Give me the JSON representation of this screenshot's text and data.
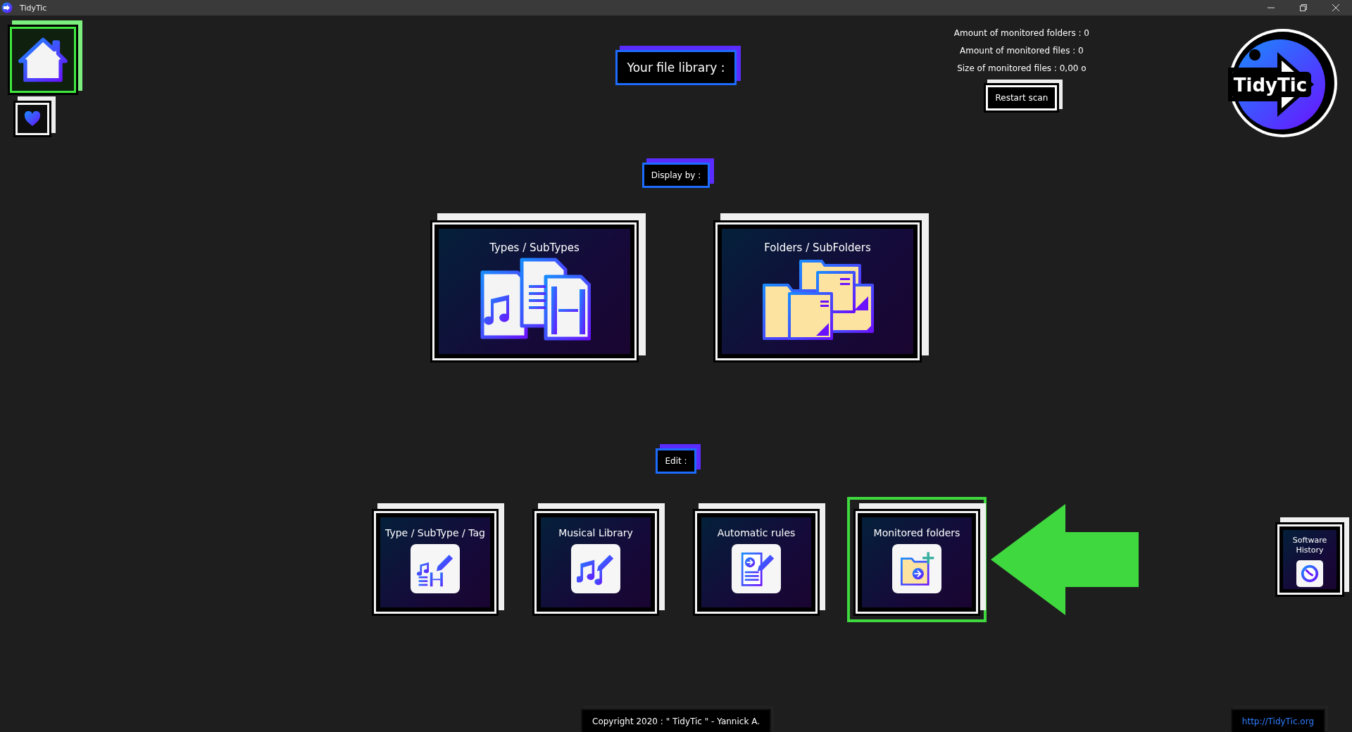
{
  "window": {
    "title": "TidyTic"
  },
  "nav": [
    {
      "kind": "home",
      "selected": true
    },
    {
      "kind": "favorites",
      "selected": false
    }
  ],
  "library_label": "Your file library :",
  "stats": [
    "Amount of monitored folders : 0",
    "Amount of monitored files : 0",
    "Size of monitored files : 0,00 o"
  ],
  "restart_button": "Restart scan",
  "logo": {
    "text": "TidyTic"
  },
  "display_label": "Display by :",
  "display_options": [
    {
      "kind": "types",
      "label": "Types / SubTypes"
    },
    {
      "kind": "folders",
      "label": "Folders / SubFolders"
    }
  ],
  "edit_label": "Edit :",
  "edit_options": [
    {
      "kind": "tags",
      "label": "Type / SubType / Tag",
      "highlighted": false
    },
    {
      "kind": "music",
      "label": "Musical Library",
      "highlighted": false
    },
    {
      "kind": "rules",
      "label": "Automatic rules",
      "highlighted": false
    },
    {
      "kind": "monitored",
      "label": "Monitored folders",
      "highlighted": true
    }
  ],
  "history_button": "Software History",
  "footer": {
    "copyright": "Copyright 2020 : \" TidyTic \" - Yannick A.",
    "link": "http://TidyTic.org"
  }
}
